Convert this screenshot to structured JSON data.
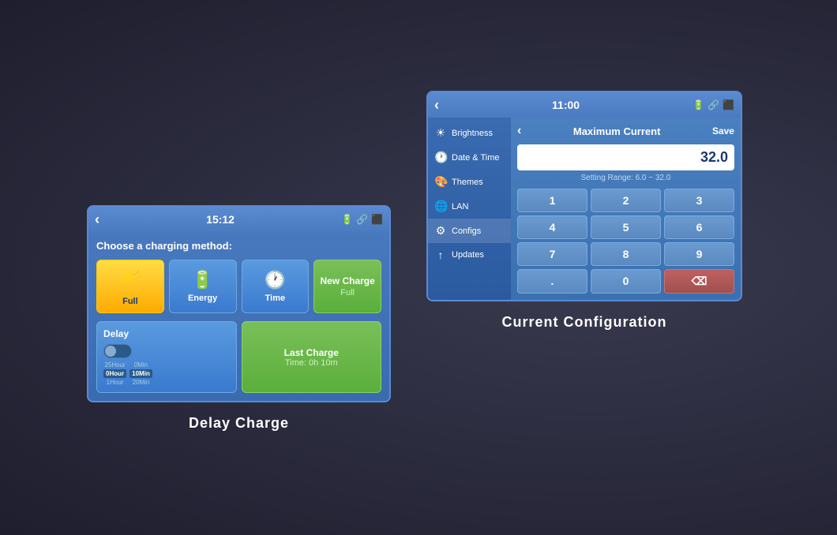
{
  "left_panel": {
    "header": {
      "back": "‹",
      "time": "15:12",
      "icons": "🔋🔗🔀"
    },
    "choose_label": "Choose a charging method:",
    "methods": [
      {
        "id": "full",
        "label": "Full",
        "icon": "⚡"
      },
      {
        "id": "energy",
        "label": "Energy",
        "icon": "🔋"
      },
      {
        "id": "time",
        "label": "Time",
        "icon": "🕐"
      }
    ],
    "new_charge": {
      "main": "New Charge",
      "sub": "Full"
    },
    "delay": {
      "label": "Delay",
      "time_options": {
        "hours": [
          "25Hour",
          "0Hour",
          "1Hour"
        ],
        "minutes": [
          "0Min",
          "10Min",
          "20Min"
        ]
      }
    },
    "last_charge": {
      "label": "Last Charge",
      "time": "Time: 0h 10m"
    },
    "caption": "Delay Charge"
  },
  "right_panel": {
    "header": {
      "back": "‹",
      "time": "11:00",
      "icons": "🔋🔗🔀"
    },
    "sidebar": {
      "items": [
        {
          "id": "brightness",
          "label": "Brightness",
          "icon": "☀"
        },
        {
          "id": "datetime",
          "label": "Date & Time",
          "icon": "🕐"
        },
        {
          "id": "themes",
          "label": "Themes",
          "icon": "🎨"
        },
        {
          "id": "lan",
          "label": "LAN",
          "icon": "🌐"
        },
        {
          "id": "configs",
          "label": "Configs",
          "icon": "⚙",
          "active": true
        },
        {
          "id": "updates",
          "label": "Updates",
          "icon": "↑"
        }
      ]
    },
    "main": {
      "back": "‹",
      "title": "Maximum Current",
      "save": "Save",
      "current_value": "32.0",
      "setting_range": "Setting Range: 6.0 ~ 32.0",
      "numpad": [
        "1",
        "2",
        "3",
        "4",
        "5",
        "6",
        "7",
        "8",
        "9",
        ".",
        "0",
        "⌫"
      ]
    },
    "caption": "Current Configuration"
  }
}
